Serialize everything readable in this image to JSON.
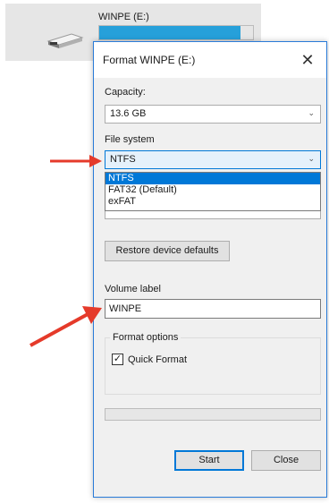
{
  "drive": {
    "name": "WINPE (E:)",
    "usage_fraction": 0.92
  },
  "dialog": {
    "title": "Format WINPE (E:)",
    "close_glyph": "✕",
    "capacity": {
      "label": "Capacity:",
      "value": "13.6 GB"
    },
    "file_system": {
      "label": "File system",
      "value": "NTFS",
      "options": [
        "NTFS",
        "FAT32 (Default)",
        "exFAT"
      ],
      "selected_index": 0
    },
    "restore_button": "Restore device defaults",
    "volume_label": {
      "label": "Volume label",
      "value": "WINPE"
    },
    "format_options": {
      "title": "Format options",
      "quick_format_label": "Quick Format",
      "quick_format_checked": true,
      "check_glyph": "✓"
    },
    "progress": 0,
    "start_button": "Start",
    "close_button": "Close"
  },
  "colors": {
    "accent": "#0078d7",
    "annotation_arrow": "#e53a2a"
  },
  "icons": [
    "drive-icon",
    "close-icon",
    "chevron-down-icon",
    "arrow-annotation"
  ]
}
